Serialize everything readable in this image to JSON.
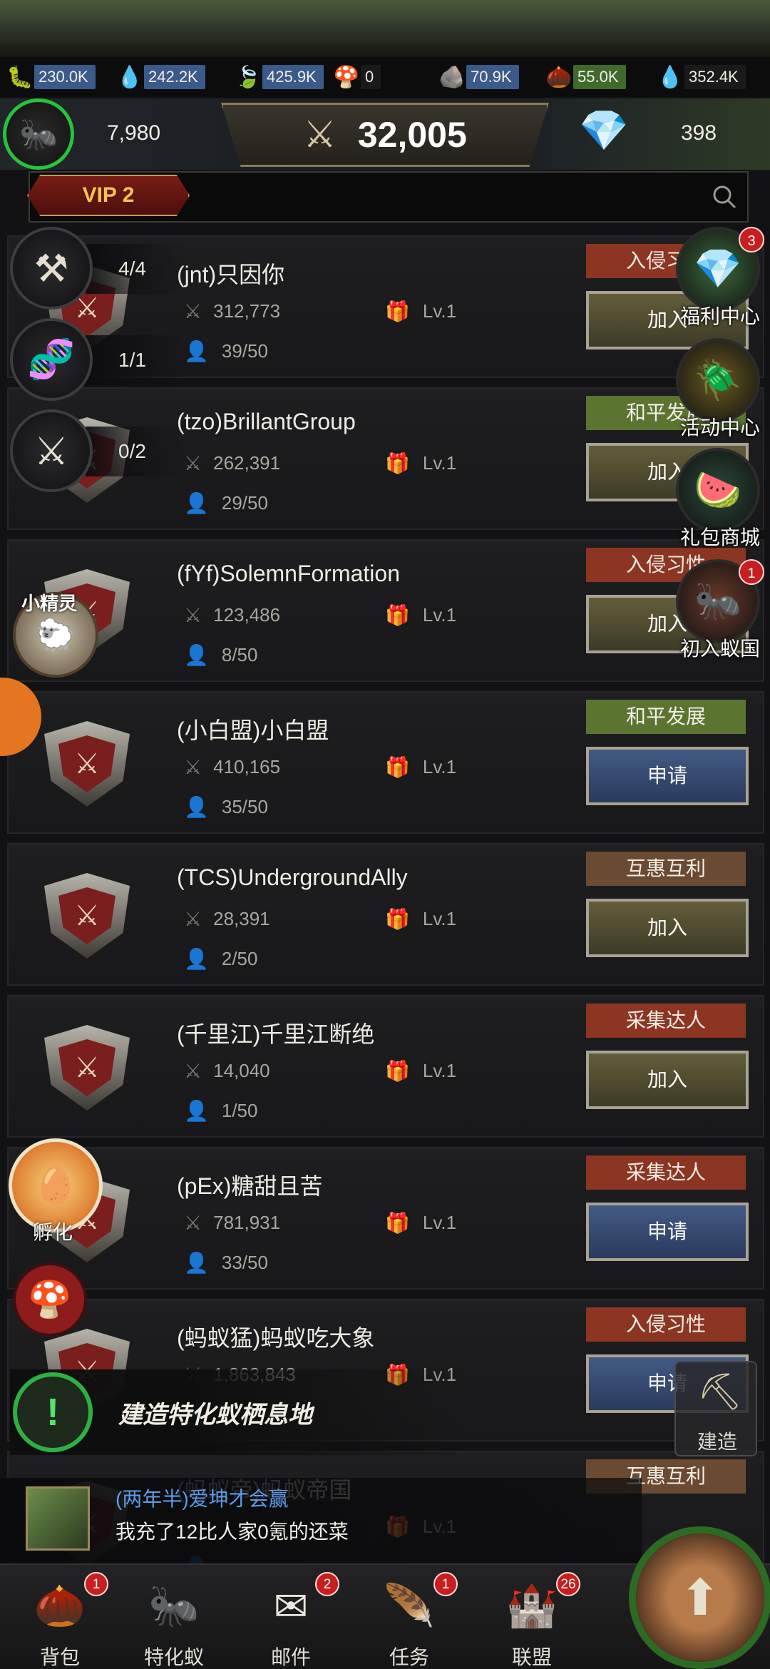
{
  "resources": [
    {
      "icon": "larva-icon",
      "glyph": "🐛",
      "value": "230.0K",
      "color": "#3a5a8a"
    },
    {
      "icon": "water-icon",
      "glyph": "💧",
      "value": "242.2K",
      "color": "#3a5a8a"
    },
    {
      "icon": "leaf-icon",
      "glyph": "🍃",
      "value": "425.9K",
      "color": "#3a5a8a"
    },
    {
      "icon": "mushroom-icon",
      "glyph": "🍄",
      "value": "0",
      "color": "#1a1a1a"
    },
    {
      "icon": "soil-icon",
      "glyph": "🪨",
      "value": "70.9K",
      "color": "#3a5a8a"
    },
    {
      "icon": "seed-icon",
      "glyph": "🌰",
      "value": "55.0K",
      "color": "#3f6a2c"
    },
    {
      "icon": "honeydew-icon",
      "glyph": "💧",
      "value": "352.4K",
      "color": "#1a1a1a"
    }
  ],
  "stats": {
    "ant_count": "7,980",
    "power": "32,005",
    "diamonds": "398"
  },
  "vip": {
    "label": "VIP 2"
  },
  "left_widgets": [
    {
      "name": "tools-widget",
      "glyph": "⚒",
      "count": "4/4"
    },
    {
      "name": "dna-widget",
      "glyph": "🧬",
      "count": "1/1"
    },
    {
      "name": "battle-widget",
      "glyph": "⚔",
      "count": "0/2"
    }
  ],
  "right_widgets": [
    {
      "name": "welfare-center",
      "label": "福利中心",
      "glyph": "💎",
      "bg": "#3c6a3a",
      "badge": "3"
    },
    {
      "name": "events-center",
      "label": "活动中心",
      "glyph": "🪲",
      "bg": "#6a5a20",
      "badge": ""
    },
    {
      "name": "gift-shop",
      "label": "礼包商城",
      "glyph": "🍉",
      "bg": "#2a4a3a",
      "badge": ""
    },
    {
      "name": "first-colony",
      "label": "初入蚁国",
      "glyph": "🐜",
      "bg": "#6a3a2a",
      "badge": "1"
    }
  ],
  "sprite_label": "小精灵",
  "hatch_label": "孵化",
  "build_task": {
    "text": "建造特化蚁栖息地"
  },
  "build_button": {
    "label": "建造"
  },
  "alliances": [
    {
      "name": "(jnt)只因你",
      "power": "312,773",
      "level": "Lv.1",
      "members": "39/50",
      "tag": "入侵习性",
      "tag_style": "red",
      "action": "加入",
      "action_style": "join"
    },
    {
      "name": "(tzo)BrillantGroup",
      "power": "262,391",
      "level": "Lv.1",
      "members": "29/50",
      "tag": "和平发展",
      "tag_style": "green",
      "action": "加入",
      "action_style": "join"
    },
    {
      "name": "(fYf)SolemnFormation",
      "power": "123,486",
      "level": "Lv.1",
      "members": "8/50",
      "tag": "入侵习性",
      "tag_style": "red",
      "action": "加入",
      "action_style": "join"
    },
    {
      "name": "(小白盟)小白盟",
      "power": "410,165",
      "level": "Lv.1",
      "members": "35/50",
      "tag": "和平发展",
      "tag_style": "green",
      "action": "申请",
      "action_style": "apply"
    },
    {
      "name": "(TCS)UndergroundAlly",
      "power": "28,391",
      "level": "Lv.1",
      "members": "2/50",
      "tag": "互惠互利",
      "tag_style": "brown",
      "action": "加入",
      "action_style": "join"
    },
    {
      "name": "(千里江)千里江断绝",
      "power": "14,040",
      "level": "Lv.1",
      "members": "1/50",
      "tag": "采集达人",
      "tag_style": "red",
      "action": "加入",
      "action_style": "join"
    },
    {
      "name": "(pEx)糖甜且苦",
      "power": "781,931",
      "level": "Lv.1",
      "members": "33/50",
      "tag": "采集达人",
      "tag_style": "red",
      "action": "申请",
      "action_style": "apply"
    },
    {
      "name": "(蚂蚁猛)蚂蚁吃大象",
      "power": "1,863,843",
      "level": "Lv.1",
      "members": "",
      "tag": "入侵习性",
      "tag_style": "red",
      "action": "申请",
      "action_style": "apply"
    },
    {
      "name": "(蚂蚁帝)蚂蚁帝国",
      "power": "",
      "level": "Lv.1",
      "members": "",
      "tag": "互惠互利",
      "tag_style": "brown",
      "action": "",
      "action_style": "join"
    }
  ],
  "chat": {
    "sender": "(两年半)爱坤才会赢",
    "message": "我充了12比人家0氪的还菜"
  },
  "nav": [
    {
      "name": "backpack",
      "label": "背包",
      "glyph": "🌰",
      "badge": "1"
    },
    {
      "name": "special-ants",
      "label": "特化蚁",
      "glyph": "🐜",
      "badge": ""
    },
    {
      "name": "mail",
      "label": "邮件",
      "glyph": "✉",
      "badge": "2"
    },
    {
      "name": "tasks",
      "label": "任务",
      "glyph": "🪶",
      "badge": "1"
    },
    {
      "name": "alliance",
      "label": "联盟",
      "glyph": "🏰",
      "badge": "26"
    }
  ]
}
